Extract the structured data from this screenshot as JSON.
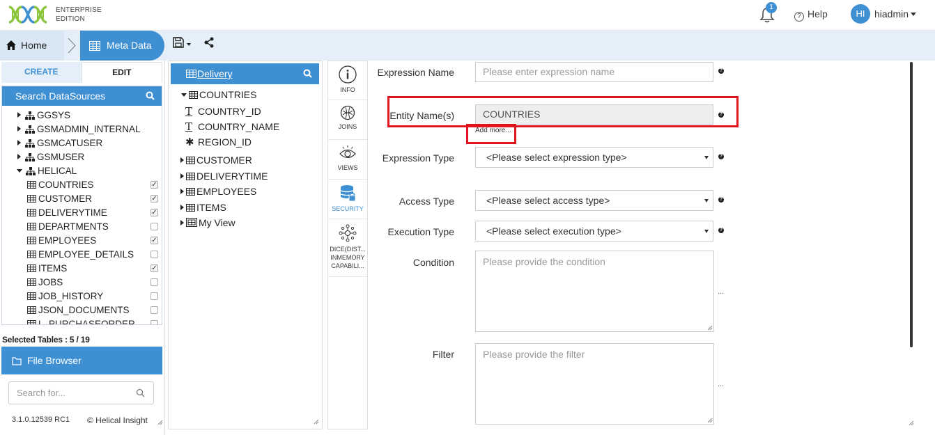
{
  "header": {
    "edition_line1": "ENTERPRISE",
    "edition_line2": "EDITION",
    "notif_count": "1",
    "help_label": "Help",
    "avatar_initials": "HI",
    "username": "hiadmin"
  },
  "breadcrumb": {
    "home_label": "Home",
    "meta_label": "Meta Data"
  },
  "left": {
    "tab_create": "CREATE",
    "tab_edit": "EDIT",
    "datasources_title": "Search DataSources",
    "schemas": [
      {
        "label": "GGSYS"
      },
      {
        "label": "GSMADMIN_INTERNAL"
      },
      {
        "label": "GSMCATUSER"
      },
      {
        "label": "GSMUSER"
      },
      {
        "label": "HELICAL"
      }
    ],
    "tables": [
      {
        "label": "COUNTRIES",
        "checked": true
      },
      {
        "label": "CUSTOMER",
        "checked": true
      },
      {
        "label": "DELIVERYTIME",
        "checked": true
      },
      {
        "label": "DEPARTMENTS",
        "checked": false
      },
      {
        "label": "EMPLOYEES",
        "checked": true
      },
      {
        "label": "EMPLOYEE_DETAILS",
        "checked": false
      },
      {
        "label": "ITEMS",
        "checked": true
      },
      {
        "label": "JOBS",
        "checked": false
      },
      {
        "label": "JOB_HISTORY",
        "checked": false
      },
      {
        "label": "JSON_DOCUMENTS",
        "checked": false
      },
      {
        "label": "L_PURCHASEORDER",
        "checked": false
      }
    ],
    "selected_tables": "Selected Tables : 5 / 19",
    "file_browser": "File Browser",
    "search_placeholder": "Search for...",
    "version": "3.1.0.12539 RC1",
    "copyright": "© Helical Insight"
  },
  "middle": {
    "title": "Delivery",
    "open_table": "COUNTRIES",
    "columns": [
      {
        "label": "COUNTRY_ID",
        "kind": "text"
      },
      {
        "label": "COUNTRY_NAME",
        "kind": "text"
      },
      {
        "label": "REGION_ID",
        "kind": "number"
      }
    ],
    "tables": [
      "CUSTOMER",
      "DELIVERYTIME",
      "EMPLOYEES",
      "ITEMS"
    ],
    "view": "My View"
  },
  "strip": {
    "items": [
      {
        "label": "INFO",
        "icon": "info-icon"
      },
      {
        "label": "JOINS",
        "icon": "joins-icon"
      },
      {
        "label": "VIEWS",
        "icon": "eye-icon"
      },
      {
        "label": "SECURITY",
        "icon": "database-lock-icon",
        "active": true
      },
      {
        "label": "DICE(DIST... INMEMORY CAPABILI...",
        "icon": "dice-icon"
      }
    ]
  },
  "form": {
    "expr_name_label": "Expression Name",
    "expr_name_placeholder": "Please enter expression name",
    "entity_label": "Entity Name(s)",
    "entity_value": "COUNTRIES",
    "add_more": "Add more...",
    "expr_type_label": "Expression Type",
    "expr_type_value": "<Please select expression type>",
    "access_label": "Access Type",
    "access_value": "<Please select access type>",
    "exec_label": "Execution Type",
    "exec_value": "<Please select execution type>",
    "condition_label": "Condition",
    "condition_placeholder": "Please provide the condition",
    "filter_label": "Filter",
    "filter_placeholder": "Please provide the filter",
    "help_mark": "?",
    "ellipsis": "..."
  },
  "colors": {
    "accent": "#3f8fd3",
    "highlight": "#e0151f",
    "logo_green": "#8cc63f"
  }
}
